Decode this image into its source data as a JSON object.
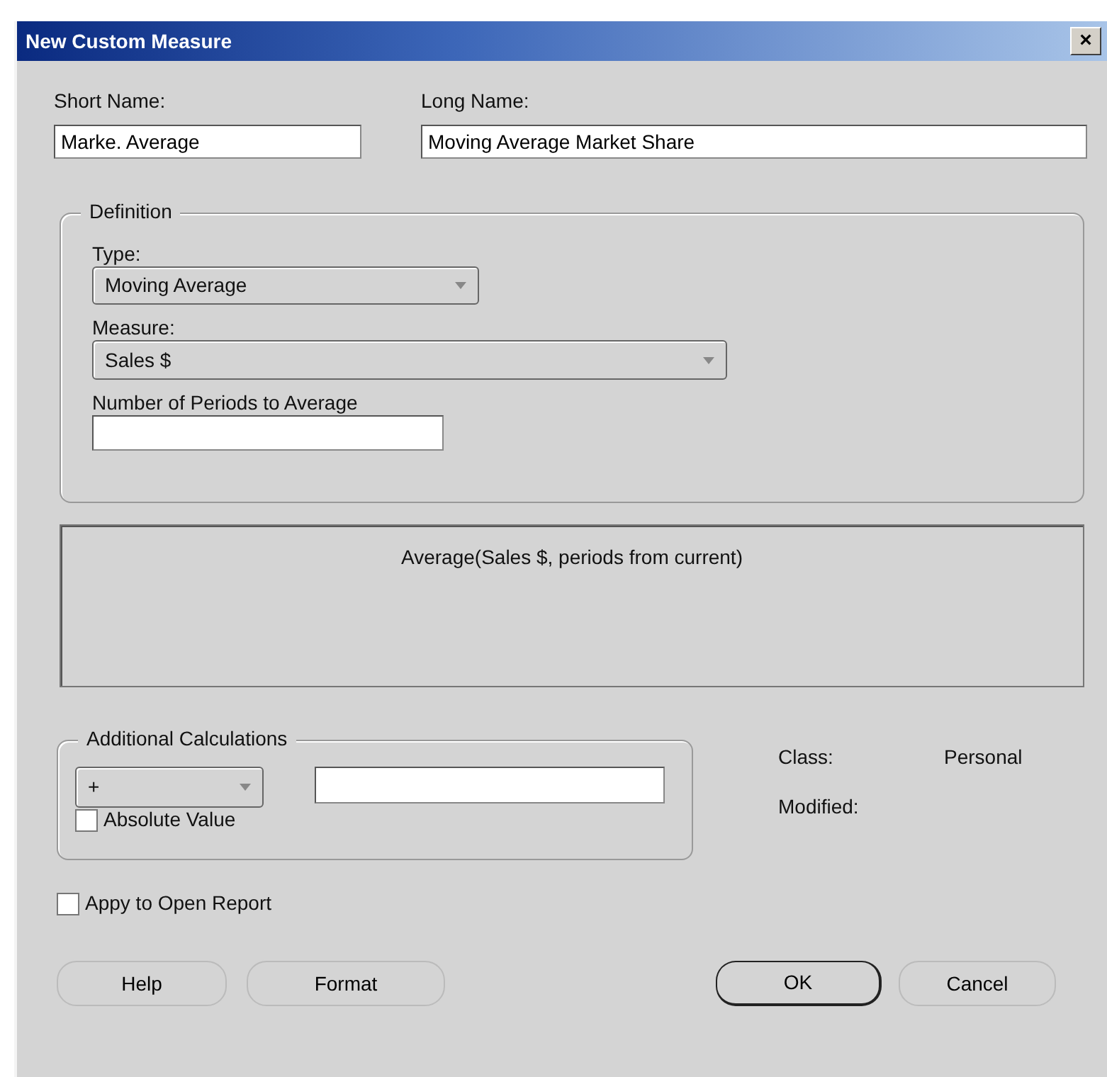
{
  "window": {
    "title": "New Custom Measure",
    "close": "×"
  },
  "short_name": {
    "label": "Short Name:",
    "value": "Marke. Average"
  },
  "long_name": {
    "label": "Long Name:",
    "value": "Moving Average Market Share"
  },
  "definition": {
    "legend": "Definition",
    "type": {
      "label": "Type:",
      "value": "Moving Average"
    },
    "measure": {
      "label": "Measure:",
      "value": "Sales $"
    },
    "periods": {
      "label": "Number of Periods to Average"
    }
  },
  "formula": "Average(Sales $, periods from current)",
  "additional": {
    "legend": "Additional Calculations",
    "operator": "+",
    "absolute_value": {
      "label": "Absolute Value",
      "checked": false
    }
  },
  "info": [
    {
      "label": "Class:",
      "value": "Personal"
    },
    {
      "label": "Modified:"
    }
  ],
  "apply_to_report": {
    "label": "Appy to Open Report",
    "checked": false
  },
  "buttons": [
    {
      "label": "Help",
      "default": false
    },
    {
      "label": "Format",
      "default": false
    },
    {
      "label": "OK",
      "default": true
    },
    {
      "label": "Cancel",
      "default": false
    }
  ]
}
